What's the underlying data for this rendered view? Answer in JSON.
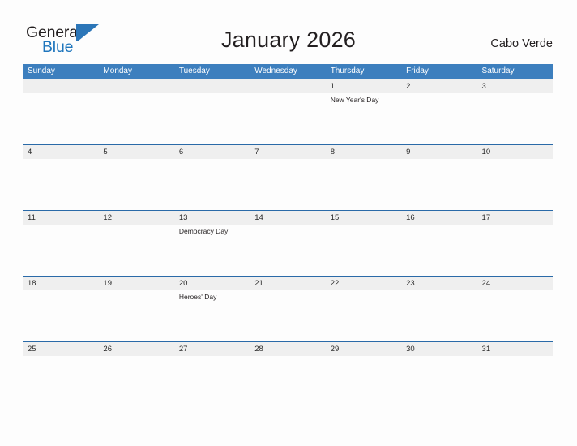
{
  "brand": {
    "word_one": "General",
    "word_two": "Blue",
    "flag_icon": "flag-triangle-icon",
    "accent_color": "#1f76bd"
  },
  "header": {
    "title": "January 2026",
    "subtitle": "Cabo Verde"
  },
  "theme": {
    "header_blue": "#3d7fbe",
    "row_divider_blue": "#2a6aa8",
    "date_strip_gray": "#efefef",
    "text_dark": "#231f20",
    "page_background": "#fdfdfd"
  },
  "calendar": {
    "weekdays": [
      "Sunday",
      "Monday",
      "Tuesday",
      "Wednesday",
      "Thursday",
      "Friday",
      "Saturday"
    ],
    "weeks": [
      {
        "days": [
          {
            "date": "",
            "event": ""
          },
          {
            "date": "",
            "event": ""
          },
          {
            "date": "",
            "event": ""
          },
          {
            "date": "",
            "event": ""
          },
          {
            "date": "1",
            "event": "New Year's Day"
          },
          {
            "date": "2",
            "event": ""
          },
          {
            "date": "3",
            "event": ""
          }
        ]
      },
      {
        "days": [
          {
            "date": "4",
            "event": ""
          },
          {
            "date": "5",
            "event": ""
          },
          {
            "date": "6",
            "event": ""
          },
          {
            "date": "7",
            "event": ""
          },
          {
            "date": "8",
            "event": ""
          },
          {
            "date": "9",
            "event": ""
          },
          {
            "date": "10",
            "event": ""
          }
        ]
      },
      {
        "days": [
          {
            "date": "11",
            "event": ""
          },
          {
            "date": "12",
            "event": ""
          },
          {
            "date": "13",
            "event": "Democracy Day"
          },
          {
            "date": "14",
            "event": ""
          },
          {
            "date": "15",
            "event": ""
          },
          {
            "date": "16",
            "event": ""
          },
          {
            "date": "17",
            "event": ""
          }
        ]
      },
      {
        "days": [
          {
            "date": "18",
            "event": ""
          },
          {
            "date": "19",
            "event": ""
          },
          {
            "date": "20",
            "event": "Heroes' Day"
          },
          {
            "date": "21",
            "event": ""
          },
          {
            "date": "22",
            "event": ""
          },
          {
            "date": "23",
            "event": ""
          },
          {
            "date": "24",
            "event": ""
          }
        ]
      },
      {
        "days": [
          {
            "date": "25",
            "event": ""
          },
          {
            "date": "26",
            "event": ""
          },
          {
            "date": "27",
            "event": ""
          },
          {
            "date": "28",
            "event": ""
          },
          {
            "date": "29",
            "event": ""
          },
          {
            "date": "30",
            "event": ""
          },
          {
            "date": "31",
            "event": ""
          }
        ]
      }
    ]
  }
}
